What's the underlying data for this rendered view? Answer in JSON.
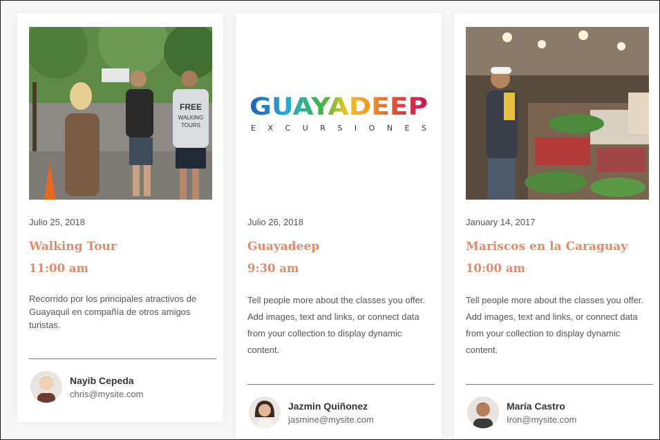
{
  "cards": [
    {
      "date": "Julio 25, 2018",
      "title": "Walking Tour",
      "time": "11:00 am",
      "description": "Recorrido por los principales atractivos de Guayaquil en compañía de otros amigos turistas.",
      "author_name": "Nayib Cepeda",
      "author_email": "chris@mysite.com",
      "image": "street-tour-photo",
      "shirt_text": [
        "FREE",
        "WALKING",
        "TOURS"
      ]
    },
    {
      "date": "Julio 26, 2018",
      "title": "Guayadeep",
      "time": "9:30 am",
      "description": "Tell people more about the classes you offer. Add images, text and links, or connect data from your collection to display dynamic content.",
      "author_name": "Jazmin Quiñonez",
      "author_email": "jasmine@mysite.com",
      "logo_word": "GUAYADEEP",
      "logo_sub": "E X C U R S I O N E S"
    },
    {
      "date": "January 14, 2017",
      "title": "Mariscos en la Caraguay",
      "time": "10:00 am",
      "description": "Tell people more about the classes you offer. Add images, text and links, or connect data from your collection to display dynamic content.",
      "author_name": "María Castro",
      "author_email": "Iron@mysite.com",
      "image": "seafood-market-photo"
    }
  ],
  "colors": {
    "accent": "#e38a6c",
    "logo_gradient": [
      "#1f5fb8",
      "#2aa6d8",
      "#3cb44a",
      "#f2c21b",
      "#f28c28",
      "#e23b3b",
      "#c2185b"
    ]
  }
}
